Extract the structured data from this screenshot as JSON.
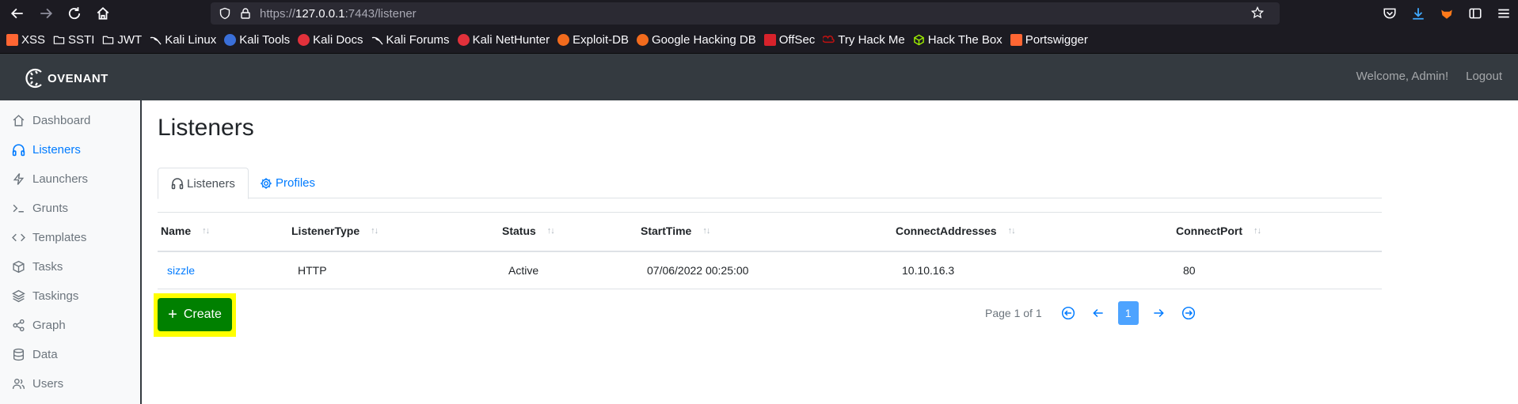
{
  "browser": {
    "url_scheme": "https://",
    "url_host": "127.0.0.1",
    "url_rest": ":7443/listener",
    "bookmarks": [
      {
        "label": "XSS",
        "icon": "portswigger-icon",
        "color": "#ff6633"
      },
      {
        "label": "SSTI",
        "icon": "folder-icon",
        "color": "#fbfbfe"
      },
      {
        "label": "JWT",
        "icon": "folder-icon",
        "color": "#fbfbfe"
      },
      {
        "label": "Kali Linux",
        "icon": "kali-icon",
        "color": "#fbfbfe"
      },
      {
        "label": "Kali Tools",
        "icon": "kali-tools-icon",
        "color": "#3a6fd8"
      },
      {
        "label": "Kali Docs",
        "icon": "kali-docs-icon",
        "color": "#e2313b"
      },
      {
        "label": "Kali Forums",
        "icon": "kali-icon",
        "color": "#fbfbfe"
      },
      {
        "label": "Kali NetHunter",
        "icon": "nethunter-icon",
        "color": "#e2313b"
      },
      {
        "label": "Exploit-DB",
        "icon": "exploitdb-icon",
        "color": "#f26b1d"
      },
      {
        "label": "Google Hacking DB",
        "icon": "ghdb-icon",
        "color": "#f26b1d"
      },
      {
        "label": "OffSec",
        "icon": "offsec-icon",
        "color": "#d7222b"
      },
      {
        "label": "Try Hack Me",
        "icon": "tryhackme-icon",
        "color": "#c11111"
      },
      {
        "label": "Hack The Box",
        "icon": "hackthebox-icon",
        "color": "#9fef00"
      },
      {
        "label": "Portswigger",
        "icon": "portswigger-icon",
        "color": "#ff6633"
      }
    ]
  },
  "navbar": {
    "brand": "OVENANT",
    "welcome": "Welcome, Admin!",
    "logout": "Logout"
  },
  "sidebar": {
    "items": [
      {
        "label": "Dashboard",
        "icon": "home-icon",
        "active": false
      },
      {
        "label": "Listeners",
        "icon": "headphones-icon",
        "active": true
      },
      {
        "label": "Launchers",
        "icon": "lightning-icon",
        "active": false
      },
      {
        "label": "Grunts",
        "icon": "terminal-icon",
        "active": false
      },
      {
        "label": "Templates",
        "icon": "code-icon",
        "active": false
      },
      {
        "label": "Tasks",
        "icon": "box-icon",
        "active": false
      },
      {
        "label": "Taskings",
        "icon": "layers-icon",
        "active": false
      },
      {
        "label": "Graph",
        "icon": "share-icon",
        "active": false
      },
      {
        "label": "Data",
        "icon": "database-icon",
        "active": false
      },
      {
        "label": "Users",
        "icon": "users-icon",
        "active": false
      }
    ]
  },
  "main": {
    "title": "Listeners",
    "tabs": [
      {
        "label": "Listeners",
        "icon": "headphones-icon",
        "active": true
      },
      {
        "label": "Profiles",
        "icon": "gear-icon",
        "active": false
      }
    ],
    "table": {
      "sort_glyph": "↑↓",
      "columns": [
        "Name",
        "ListenerType",
        "Status",
        "StartTime",
        "ConnectAddresses",
        "ConnectPort"
      ],
      "rows": [
        [
          "sizzle",
          "HTTP",
          "Active",
          "07/06/2022 00:25:00",
          "10.10.16.3",
          "80"
        ]
      ]
    },
    "create_label": "Create",
    "create_highlight_color": "#ffff00",
    "pagination": {
      "text": "Page 1 of 1",
      "current": "1"
    }
  },
  "colors": {
    "accent": "#007bff",
    "navbar": "#343a40",
    "create": "#008000"
  }
}
